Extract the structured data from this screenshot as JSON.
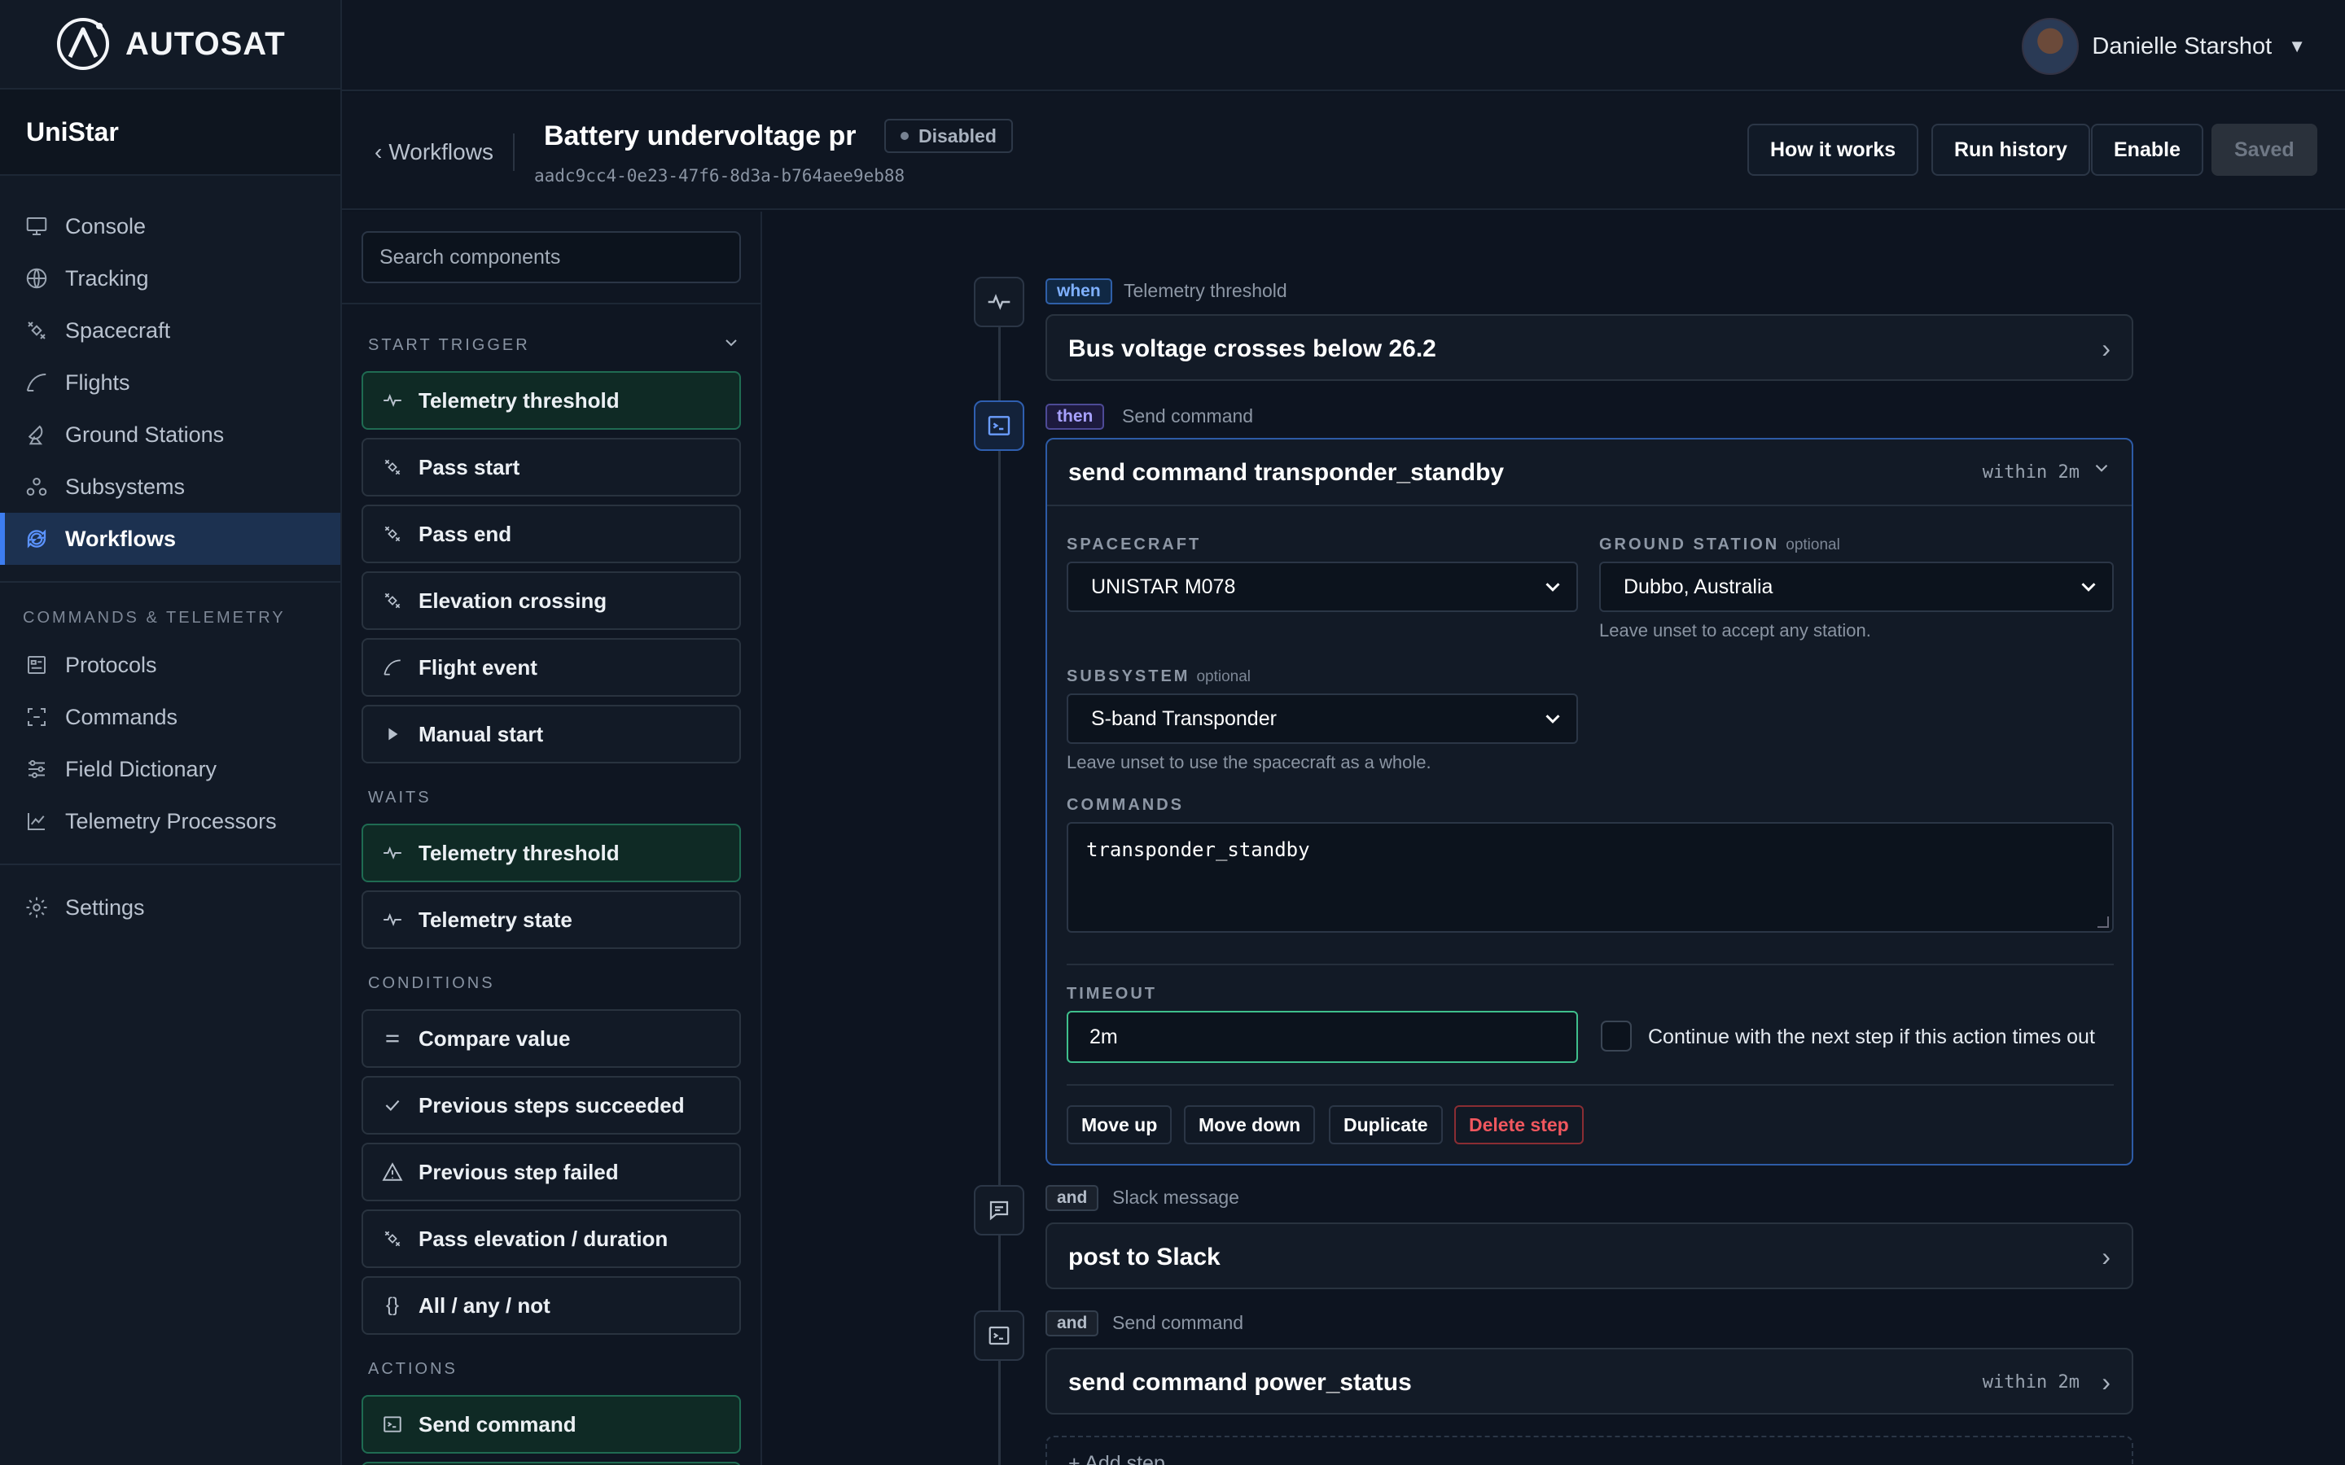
{
  "app": {
    "brand": "AUTOSAT",
    "org": "UniStar"
  },
  "user": {
    "name": "Danielle Starshot"
  },
  "sidebar": {
    "items": [
      {
        "label": "Console",
        "icon": "monitor-icon"
      },
      {
        "label": "Tracking",
        "icon": "globe-icon"
      },
      {
        "label": "Spacecraft",
        "icon": "satellite-icon"
      },
      {
        "label": "Flights",
        "icon": "trajectory-icon"
      },
      {
        "label": "Ground Stations",
        "icon": "antenna-icon"
      },
      {
        "label": "Subsystems",
        "icon": "nodes-icon"
      },
      {
        "label": "Workflows",
        "icon": "workflow-icon",
        "active": true
      }
    ],
    "section_title": "COMMANDS & TELEMETRY",
    "section_items": [
      {
        "label": "Protocols",
        "icon": "protocol-icon"
      },
      {
        "label": "Commands",
        "icon": "brackets-icon"
      },
      {
        "label": "Field Dictionary",
        "icon": "sliders-icon"
      },
      {
        "label": "Telemetry Processors",
        "icon": "chart-icon"
      }
    ],
    "settings": {
      "label": "Settings",
      "icon": "gear-icon"
    }
  },
  "workflow": {
    "back_label": "Workflows",
    "title": "Battery undervoltage pr",
    "status": "Disabled",
    "id": "aadc9cc4-0e23-47f6-8d3a-b764aee9eb88",
    "buttons": {
      "how": "How it works",
      "history": "Run history",
      "enable": "Enable",
      "saved": "Saved"
    }
  },
  "components": {
    "search_placeholder": "Search components",
    "groups": {
      "start_trigger": "START TRIGGER",
      "waits": "WAITS",
      "conditions": "CONDITIONS",
      "actions": "ACTIONS"
    },
    "start_trigger": [
      "Telemetry threshold",
      "Pass start",
      "Pass end",
      "Elevation crossing",
      "Flight event",
      "Manual start"
    ],
    "waits": [
      "Telemetry threshold",
      "Telemetry state"
    ],
    "conditions": [
      "Compare value",
      "Previous steps succeeded",
      "Previous step failed",
      "Pass elevation / duration",
      "All / any / not"
    ],
    "actions": [
      "Send command"
    ]
  },
  "steps": {
    "trigger": {
      "tag": "when",
      "kind": "Telemetry threshold",
      "title": "Bus voltage crosses below 26.2"
    },
    "active": {
      "tag": "then",
      "kind": "Send command",
      "title": "send command transponder_standby",
      "within": "within 2m",
      "spacecraft_label": "SPACECRAFT",
      "spacecraft_value": "UNISTAR M078",
      "ground_label": "GROUND STATION",
      "optional": "optional",
      "ground_value": "Dubbo, Australia",
      "ground_hint": "Leave unset to accept any station.",
      "subsystem_label": "SUBSYSTEM",
      "subsystem_value": "S-band Transponder",
      "subsystem_hint": "Leave unset to use the spacecraft as a whole.",
      "commands_label": "COMMANDS",
      "commands_value": "transponder_standby",
      "timeout_label": "TIMEOUT",
      "timeout_value": "2m",
      "continue_label": "Continue with the next step if this action times out",
      "actions": {
        "move_up": "Move up",
        "move_down": "Move down",
        "duplicate": "Duplicate",
        "delete": "Delete step"
      }
    },
    "slack": {
      "tag": "and",
      "kind": "Slack message",
      "title": "post to Slack"
    },
    "power": {
      "tag": "and",
      "kind": "Send command",
      "title": "send command power_status",
      "within": "within 2m"
    },
    "add_step": "+ Add step"
  }
}
